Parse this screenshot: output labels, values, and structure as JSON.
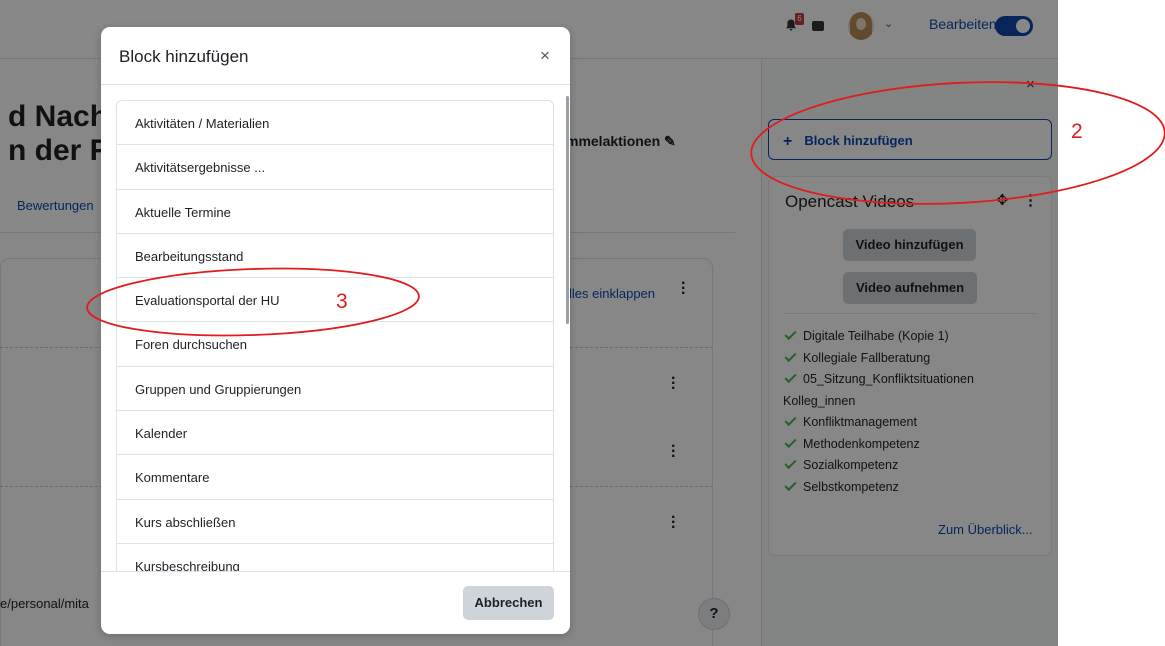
{
  "header": {
    "notification_count": "6",
    "edit_mode_label": "Bearbeiten"
  },
  "course": {
    "title_fragment": "d Nachb\nn der Re",
    "bulk_actions_label": "mmelaktionen",
    "tab_ratings": "Bewertungen",
    "collapse_all_label": "lles einklappen",
    "url_fragment": "e/personal/mita"
  },
  "drawer": {
    "close_label": "×",
    "add_block_label": "Block hinzufügen",
    "opencast": {
      "title": "Opencast Videos",
      "add_video_label": "Video hinzufügen",
      "record_video_label": "Video aufnehmen",
      "items": [
        "Digitale Teilhabe (Kopie 1)",
        "Kollegiale Fallberatung",
        "05_Sitzung_Konfliktsituationen",
        "Konfliktmanagement",
        "Methodenkompetenz",
        "Sozialkompetenz",
        "Selbstkompetenz"
      ],
      "wrapped_continuation": "Kolleg_innen",
      "overview_link": "Zum Überblick..."
    }
  },
  "modal": {
    "title": "Block hinzufügen",
    "close_label": "×",
    "items": [
      "Aktivitäten / Materialien",
      "Aktivitätsergebnisse ...",
      "Aktuelle Termine",
      "Bearbeitungsstand",
      "Evaluationsportal der HU",
      "Foren durchsuchen",
      "Gruppen und Gruppierungen",
      "Kalender",
      "Kommentare",
      "Kurs abschließen",
      "Kursbeschreibung"
    ],
    "cancel_label": "Abbrechen"
  },
  "annotations": {
    "marker_block_button": "2",
    "marker_evaluation_item": "3",
    "color": "#e01c1c"
  },
  "help_label": "?"
}
